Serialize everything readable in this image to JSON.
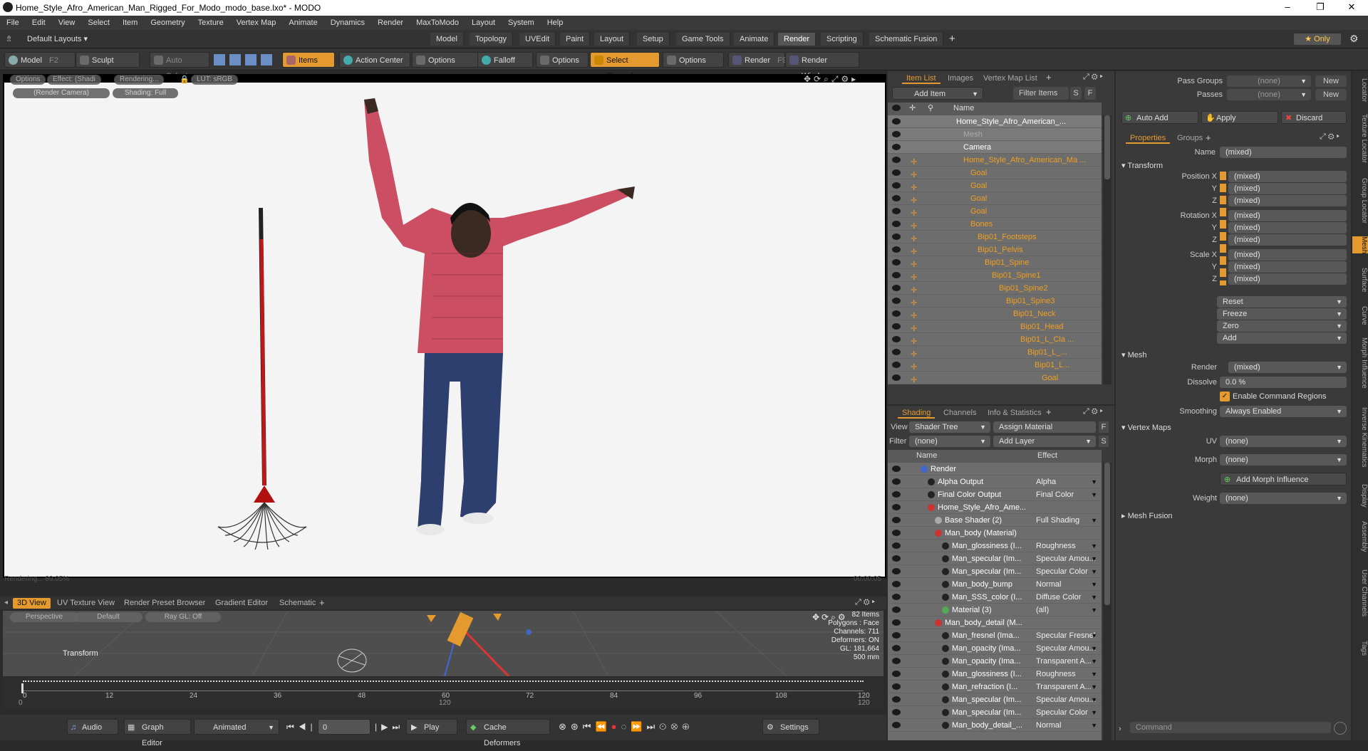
{
  "window": {
    "title": "Home_Style_Afro_American_Man_Rigged_For_Modo_modo_base.lxo* - MODO"
  },
  "menu": [
    "File",
    "Edit",
    "View",
    "Select",
    "Item",
    "Geometry",
    "Texture",
    "Vertex Map",
    "Animate",
    "Dynamics",
    "Render",
    "MaxToModo",
    "Layout",
    "System",
    "Help"
  ],
  "layout": {
    "selector": "Default Layouts ▾",
    "tabs": [
      "Model",
      "Topology",
      "UVEdit",
      "Paint",
      "Layout",
      "Setup",
      "Game Tools",
      "Animate",
      "Render",
      "Scripting",
      "Schematic Fusion"
    ],
    "active_tab": "Render",
    "only": "★ Only"
  },
  "toolbar": {
    "model": "Model",
    "model_key": "F2",
    "sculpt": "Sculpt",
    "auto_select": "Auto Select",
    "items": "Items",
    "action_center": "Action Center",
    "options1": "Options",
    "falloff": "Falloff",
    "options2": "Options",
    "select_through": "Select Through",
    "options3": "Options",
    "render": "Render",
    "render_key": "F9",
    "render_window": "Render Window"
  },
  "viewport": {
    "buttons": [
      "Options",
      "Effect: (Shadi",
      "Rendering...",
      "LUT: sRGB"
    ],
    "buttons2": [
      "(Render Camera)",
      "Shading: Full"
    ],
    "status": "Rendering... 89.05%",
    "time": "00:00:05"
  },
  "lower": {
    "tabs": [
      "3D View",
      "UV Texture View",
      "Render Preset Browser",
      "Gradient Editor",
      "Schematic"
    ],
    "perspective": "Perspective",
    "default": "Default",
    "raygl": "Ray GL: Off",
    "transform_label": "Transform",
    "stats": [
      "82 Items",
      "Polygons : Face",
      "Channels: 711",
      "Deformers: ON",
      "GL: 181,664",
      "500 mm"
    ]
  },
  "timeline": {
    "ticks": [
      "0",
      "12",
      "24",
      "36",
      "48",
      "60",
      "72",
      "84",
      "96",
      "108",
      "120"
    ],
    "start": "0",
    "mid": "120",
    "end": "120"
  },
  "bottombar": {
    "audio": "Audio",
    "graph_editor": "Graph Editor",
    "animated": "Animated",
    "frame": "0",
    "play": "Play",
    "cache": "Cache Deformers",
    "settings": "Settings"
  },
  "itemlist": {
    "tabs": [
      "Item List",
      "Images",
      "Vertex Map List"
    ],
    "add_item": "Add Item",
    "filter_items": "Filter Items",
    "s": "S",
    "f": "F",
    "col_name": "Name",
    "rows": [
      {
        "name": "Home_Style_Afro_American_...",
        "indent": 0,
        "style": "white",
        "lock": false
      },
      {
        "name": "Mesh",
        "indent": 1,
        "style": "dim",
        "lock": false
      },
      {
        "name": "Camera",
        "indent": 1,
        "style": "white",
        "lock": false
      },
      {
        "name": "Home_Style_Afro_American_Ma ...",
        "indent": 1,
        "style": "orange",
        "lock": true
      },
      {
        "name": "Goal",
        "indent": 2,
        "style": "orange",
        "lock": true
      },
      {
        "name": "Goal",
        "indent": 2,
        "style": "orange",
        "lock": true
      },
      {
        "name": "Goal",
        "indent": 2,
        "style": "orange",
        "lock": true
      },
      {
        "name": "Goal",
        "indent": 2,
        "style": "orange",
        "lock": true
      },
      {
        "name": "Bones",
        "indent": 2,
        "style": "orange",
        "lock": true
      },
      {
        "name": "Bip01_Footsteps",
        "indent": 3,
        "style": "orange",
        "lock": true
      },
      {
        "name": "Bip01_Pelvis",
        "indent": 3,
        "style": "orange",
        "lock": true
      },
      {
        "name": "Bip01_Spine",
        "indent": 4,
        "style": "orange",
        "lock": true
      },
      {
        "name": "Bip01_Spine1",
        "indent": 5,
        "style": "orange",
        "lock": true
      },
      {
        "name": "Bip01_Spine2",
        "indent": 6,
        "style": "orange",
        "lock": true
      },
      {
        "name": "Bip01_Spine3",
        "indent": 7,
        "style": "orange",
        "lock": true
      },
      {
        "name": "Bip01_Neck",
        "indent": 8,
        "style": "orange",
        "lock": true
      },
      {
        "name": "Bip01_Head",
        "indent": 9,
        "style": "orange",
        "lock": true
      },
      {
        "name": "Bip01_L_Cla ...",
        "indent": 9,
        "style": "orange",
        "lock": true
      },
      {
        "name": "Bip01_L_...",
        "indent": 10,
        "style": "orange",
        "lock": true
      },
      {
        "name": "Bip01_L...",
        "indent": 11,
        "style": "orange",
        "lock": true
      },
      {
        "name": "Goal",
        "indent": 12,
        "style": "orange",
        "lock": true
      }
    ]
  },
  "shading": {
    "tabs": [
      "Shading",
      "Channels",
      "Info & Statistics"
    ],
    "view_label": "View",
    "view_value": "Shader Tree",
    "assign_material": "Assign Material",
    "filter_label": "Filter",
    "filter_value": "(none)",
    "add_layer": "Add Layer",
    "col_name": "Name",
    "col_effect": "Effect",
    "rows": [
      {
        "name": "Render",
        "effect": "",
        "indent": 0,
        "sw": "#4466cc"
      },
      {
        "name": "Alpha Output",
        "effect": "Alpha",
        "indent": 1,
        "sw": "#222"
      },
      {
        "name": "Final Color Output",
        "effect": "Final Color",
        "indent": 1,
        "sw": "#222"
      },
      {
        "name": "Home_Style_Afro_Ame...",
        "effect": "",
        "indent": 1,
        "sw": "#cc3333"
      },
      {
        "name": "Base Shader (2)",
        "effect": "Full Shading",
        "indent": 2,
        "sw": "#aaa"
      },
      {
        "name": "Man_body (Material)",
        "effect": "",
        "indent": 2,
        "sw": "#cc3333"
      },
      {
        "name": "Man_glossiness (I...",
        "effect": "Roughness",
        "indent": 3,
        "sw": "#222"
      },
      {
        "name": "Man_specular (Im...",
        "effect": "Specular Amou...",
        "indent": 3,
        "sw": "#222"
      },
      {
        "name": "Man_specular (Im...",
        "effect": "Specular Color",
        "indent": 3,
        "sw": "#222"
      },
      {
        "name": "Man_body_bump",
        "effect": "Normal",
        "indent": 3,
        "sw": "#222"
      },
      {
        "name": "Man_SSS_color (I...",
        "effect": "Diffuse Color",
        "indent": 3,
        "sw": "#222"
      },
      {
        "name": "Material (3)",
        "effect": "(all)",
        "indent": 3,
        "sw": "#55aa55"
      },
      {
        "name": "Man_body_detail (M...",
        "effect": "",
        "indent": 2,
        "sw": "#cc3333"
      },
      {
        "name": "Man_fresnel (Ima...",
        "effect": "Specular Fresnel",
        "indent": 3,
        "sw": "#222"
      },
      {
        "name": "Man_opacity (Ima...",
        "effect": "Specular Amou...",
        "indent": 3,
        "sw": "#222"
      },
      {
        "name": "Man_opacity (Ima...",
        "effect": "Transparent A...",
        "indent": 3,
        "sw": "#222"
      },
      {
        "name": "Man_glossiness (I...",
        "effect": "Roughness",
        "indent": 3,
        "sw": "#222"
      },
      {
        "name": "Man_refraction (I...",
        "effect": "Transparent A...",
        "indent": 3,
        "sw": "#222"
      },
      {
        "name": "Man_specular (Im...",
        "effect": "Specular Amou...",
        "indent": 3,
        "sw": "#222"
      },
      {
        "name": "Man_specular (Im...",
        "effect": "Specular Color",
        "indent": 3,
        "sw": "#222"
      },
      {
        "name": "Man_body_detail_...",
        "effect": "Normal",
        "indent": 3,
        "sw": "#222"
      }
    ]
  },
  "properties": {
    "pass_groups": "Pass Groups",
    "passes": "Passes",
    "none": "(none)",
    "new": "New",
    "auto_add": "Auto Add",
    "apply": "Apply",
    "discard": "Discard",
    "tabs": [
      "Properties",
      "Groups"
    ],
    "name_label": "Name",
    "name_value": "(mixed)",
    "transform": "Transform",
    "position_x": "Position X",
    "rotation_x": "Rotation X",
    "scale_x": "Scale X",
    "y": "Y",
    "z": "Z",
    "mixed": "(mixed)",
    "reset": "Reset",
    "freeze": "Freeze",
    "zero": "Zero",
    "add": "Add",
    "mesh": "Mesh",
    "render_label": "Render",
    "dissolve_label": "Dissolve",
    "dissolve_value": "0.0 %",
    "enable_cmd": "Enable Command Regions",
    "smoothing_label": "Smoothing",
    "smoothing_value": "Always Enabled",
    "vertex_maps": "Vertex Maps",
    "uv_label": "UV",
    "morph_label": "Morph",
    "add_morph": "Add Morph Influence",
    "weight_label": "Weight",
    "mesh_fusion": "Mesh Fusion",
    "command": "Command"
  },
  "sidetabs": [
    "Locator",
    "Texture Locator",
    "Group Locator",
    "Mesh",
    "Surface",
    "Curve",
    "Morph Influence",
    "Inverse Kinematics",
    "Display",
    "Assembly",
    "User Channels",
    "Tags"
  ]
}
